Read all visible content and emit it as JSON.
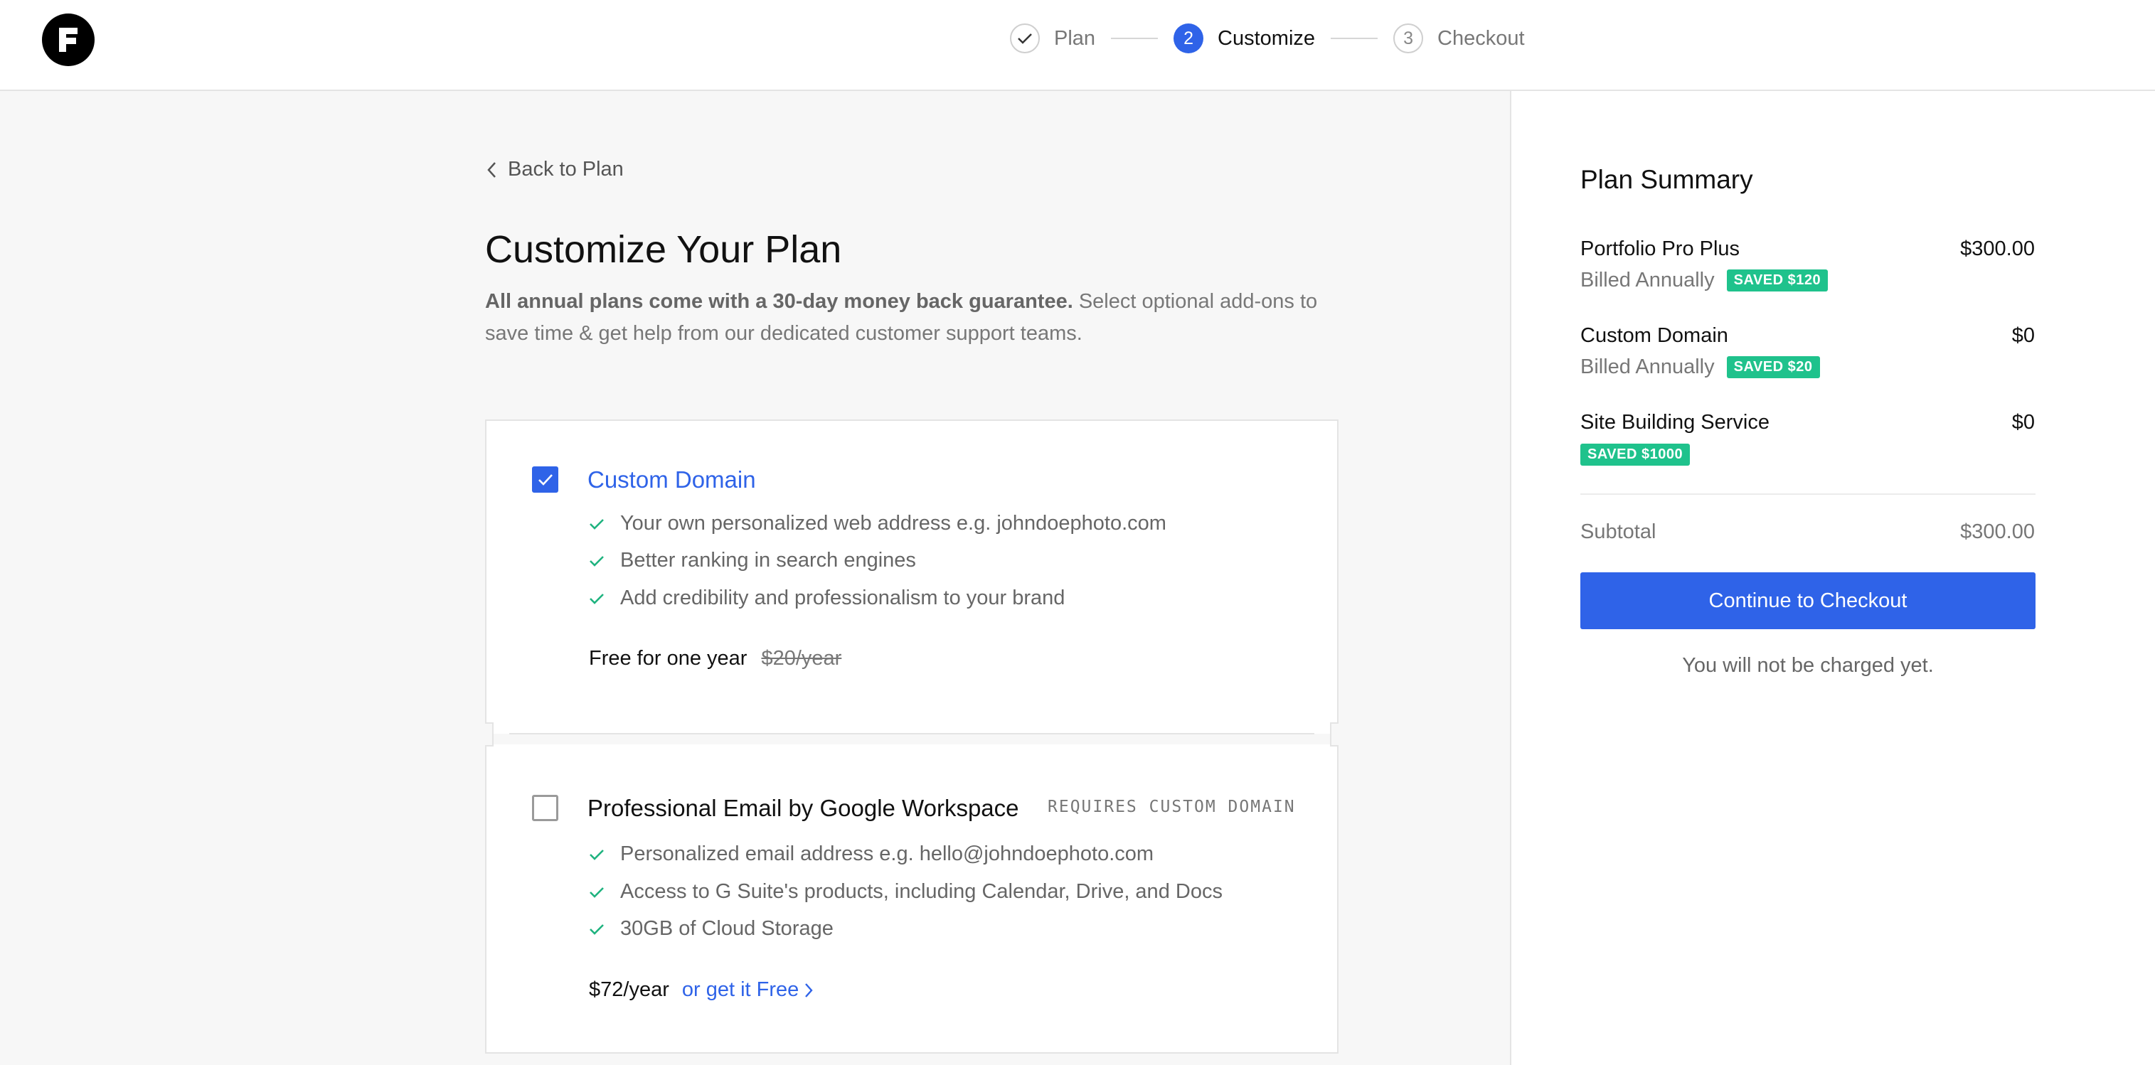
{
  "brand": {
    "logo_letter": "F"
  },
  "stepper": {
    "steps": [
      {
        "number": "1",
        "label": "Plan",
        "state": "done"
      },
      {
        "number": "2",
        "label": "Customize",
        "state": "active"
      },
      {
        "number": "3",
        "label": "Checkout",
        "state": "todo"
      }
    ]
  },
  "main": {
    "back_link": "Back to Plan",
    "title": "Customize Your Plan",
    "desc_bold": "All annual plans come with a 30-day money back guarantee.",
    "desc_rest": " Select optional add-ons to save time & get help from our dedicated customer support teams."
  },
  "addons": [
    {
      "title": "Custom Domain",
      "checked": true,
      "features": [
        "Your own personalized web address e.g. johndoephoto.com",
        "Better ranking in search engines",
        "Add credibility and professionalism to your brand"
      ],
      "price": "Free for one year",
      "original_price": "$20/year"
    },
    {
      "title": "Professional Email by Google Workspace",
      "checked": false,
      "tag": "REQUIRES CUSTOM DOMAIN",
      "features": [
        "Personalized email address e.g. hello@johndoephoto.com",
        "Access to G Suite's products, including Calendar, Drive, and Docs",
        "30GB of Cloud Storage"
      ],
      "price": "$72/year",
      "free_link": "or get it Free"
    }
  ],
  "summary": {
    "title": "Plan Summary",
    "items": [
      {
        "name": "Portfolio Pro Plus",
        "price": "$300.00",
        "billing": "Billed Annually",
        "badge": "SAVED $120"
      },
      {
        "name": "Custom Domain",
        "price": "$0",
        "billing": "Billed Annually",
        "badge": "SAVED $20"
      },
      {
        "name": "Site Building Service",
        "price": "$0",
        "billing": "",
        "badge": "SAVED $1000"
      }
    ],
    "subtotal_label": "Subtotal",
    "subtotal_value": "$300.00",
    "checkout_button": "Continue to Checkout",
    "note": "You will not be charged yet."
  },
  "colors": {
    "accent": "#2f63e8",
    "success": "#1fc28c",
    "check": "#1fb37f"
  }
}
